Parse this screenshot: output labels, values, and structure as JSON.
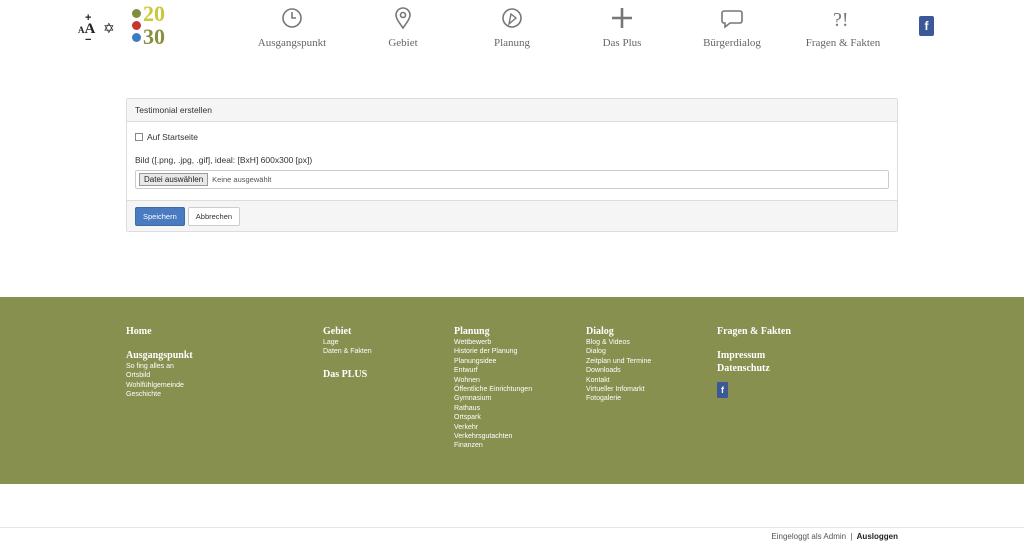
{
  "header": {
    "logo": {
      "year_top": "20",
      "year_bottom": "30"
    },
    "a11y": {
      "font_small": "A",
      "font_big": "A",
      "increase": "+",
      "decrease": "−",
      "contrast_symbol": "✡"
    },
    "nav": [
      {
        "label": "Ausgangspunkt",
        "icon": "clock-icon"
      },
      {
        "label": "Gebiet",
        "icon": "map-pin-icon"
      },
      {
        "label": "Planung",
        "icon": "compass-icon"
      },
      {
        "label": "Das Plus",
        "icon": "plus-icon"
      },
      {
        "label": "Bürgerdialog",
        "icon": "speech-bubble-icon"
      },
      {
        "label": "Fragen & Fakten",
        "icon": "question-exclamation-icon"
      }
    ],
    "fb_glyph": "f"
  },
  "panel": {
    "title": "Testimonial erstellen",
    "checkbox_label": "Auf Startseite",
    "image_label": "Bild ([.png, .jpg, .gif], ideal: [BxH] 600x300 [px])",
    "file_button": "Datei auswählen",
    "file_status": "Keine ausgewählt",
    "save_button": "Speichern",
    "cancel_button": "Abbrechen"
  },
  "footer": {
    "home": "Home",
    "ausgangspunkt": {
      "title": "Ausgangspunkt",
      "links": [
        "So fing alles an",
        "Ortsbild",
        "Wohlfühlgemeinde",
        "Geschichte"
      ]
    },
    "gebiet": {
      "title": "Gebiet",
      "links": [
        "Lage",
        "Daten & Fakten"
      ]
    },
    "das_plus": "Das PLUS",
    "planung": {
      "title": "Planung",
      "links": [
        "Wettbewerb",
        "Historie der Planung",
        "Planungsidee",
        "Entwurf",
        "Wohnen",
        "Öffentliche Einrichtungen",
        "Gymnasium",
        "Rathaus",
        "Ortspark",
        "Verkehr",
        "Verkehrsgutachten",
        "Finanzen"
      ]
    },
    "dialog": {
      "title": "Dialog",
      "links": [
        "Blog & Videos",
        "Dialog",
        "Zeitplan und Termine",
        "Downloads",
        "Kontakt",
        "Virtueller Infomarkt",
        "Fotogalerie"
      ]
    },
    "fragen": "Fragen & Fakten",
    "impressum": "Impressum",
    "datenschutz": "Datenschutz",
    "fb_glyph": "f"
  },
  "bottom": {
    "logged_in": "Eingeloggt als Admin",
    "separator": "|",
    "logout": "Ausloggen"
  },
  "colors": {
    "footer_bg": "#87904f",
    "primary": "#4a7abf",
    "facebook": "#3b5998"
  }
}
